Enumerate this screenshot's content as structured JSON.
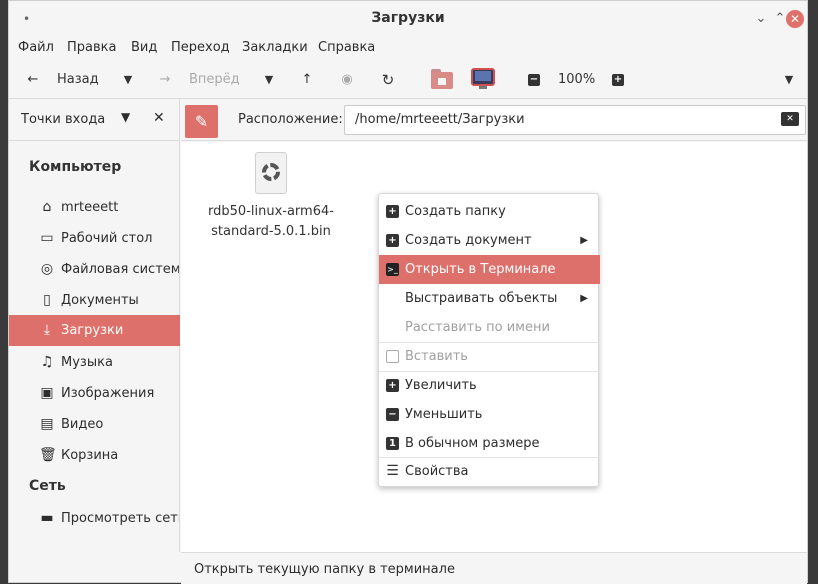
{
  "window": {
    "title": "Загрузки"
  },
  "menu": [
    "Файл",
    "Правка",
    "Вид",
    "Переход",
    "Закладки",
    "Справка"
  ],
  "toolbar": {
    "back": "Назад",
    "forward": "Вперёд",
    "zoom": "100%"
  },
  "sidebar": {
    "header": "Точки входа",
    "section_computer": "Компьютер",
    "items": [
      {
        "label": "mrteeett",
        "icon": "home-icon",
        "glyph": "⌂"
      },
      {
        "label": "Рабочий стол",
        "icon": "desktop-icon",
        "glyph": "▭"
      },
      {
        "label": "Файловая система",
        "icon": "disk-icon",
        "glyph": "◎"
      },
      {
        "label": "Документы",
        "icon": "documents-icon",
        "glyph": "▯"
      },
      {
        "label": "Загрузки",
        "icon": "download-icon",
        "glyph": "⤓"
      },
      {
        "label": "Музыка",
        "icon": "music-icon",
        "glyph": "♫"
      },
      {
        "label": "Изображения",
        "icon": "image-icon",
        "glyph": "▣"
      },
      {
        "label": "Видео",
        "icon": "video-icon",
        "glyph": "▤"
      },
      {
        "label": "Корзина",
        "icon": "trash-icon",
        "glyph": "🗑"
      }
    ],
    "section_network": "Сеть",
    "network_items": [
      {
        "label": "Просмотреть сеть",
        "icon": "network-icon",
        "glyph": "▬"
      }
    ]
  },
  "location": {
    "label": "Расположение:",
    "path": "/home/mrteeett/Загрузки"
  },
  "files": [
    {
      "name_line1": "rdb50-linux-arm64-",
      "name_line2": "standard-5.0.1.bin"
    }
  ],
  "context_menu": [
    {
      "label": "Создать папку",
      "icon": "plus-icon"
    },
    {
      "label": "Создать документ",
      "icon": "plus-icon",
      "submenu": true
    },
    {
      "label": "Открыть в Терминале",
      "icon": "terminal-icon",
      "highlighted": true
    },
    {
      "label": "Выстраивать объекты",
      "submenu": true
    },
    {
      "label": "Расставить по имени",
      "disabled": true
    },
    {
      "label": "Вставить",
      "icon": "clipboard-icon",
      "disabled": true
    },
    {
      "label": "Увеличить",
      "icon": "plus-icon"
    },
    {
      "label": "Уменьшить",
      "icon": "minus-icon"
    },
    {
      "label": "В обычном размере",
      "icon": "one-icon"
    },
    {
      "label": "Свойства",
      "icon": "properties-icon"
    }
  ],
  "status": "Открыть текущую папку в терминале"
}
